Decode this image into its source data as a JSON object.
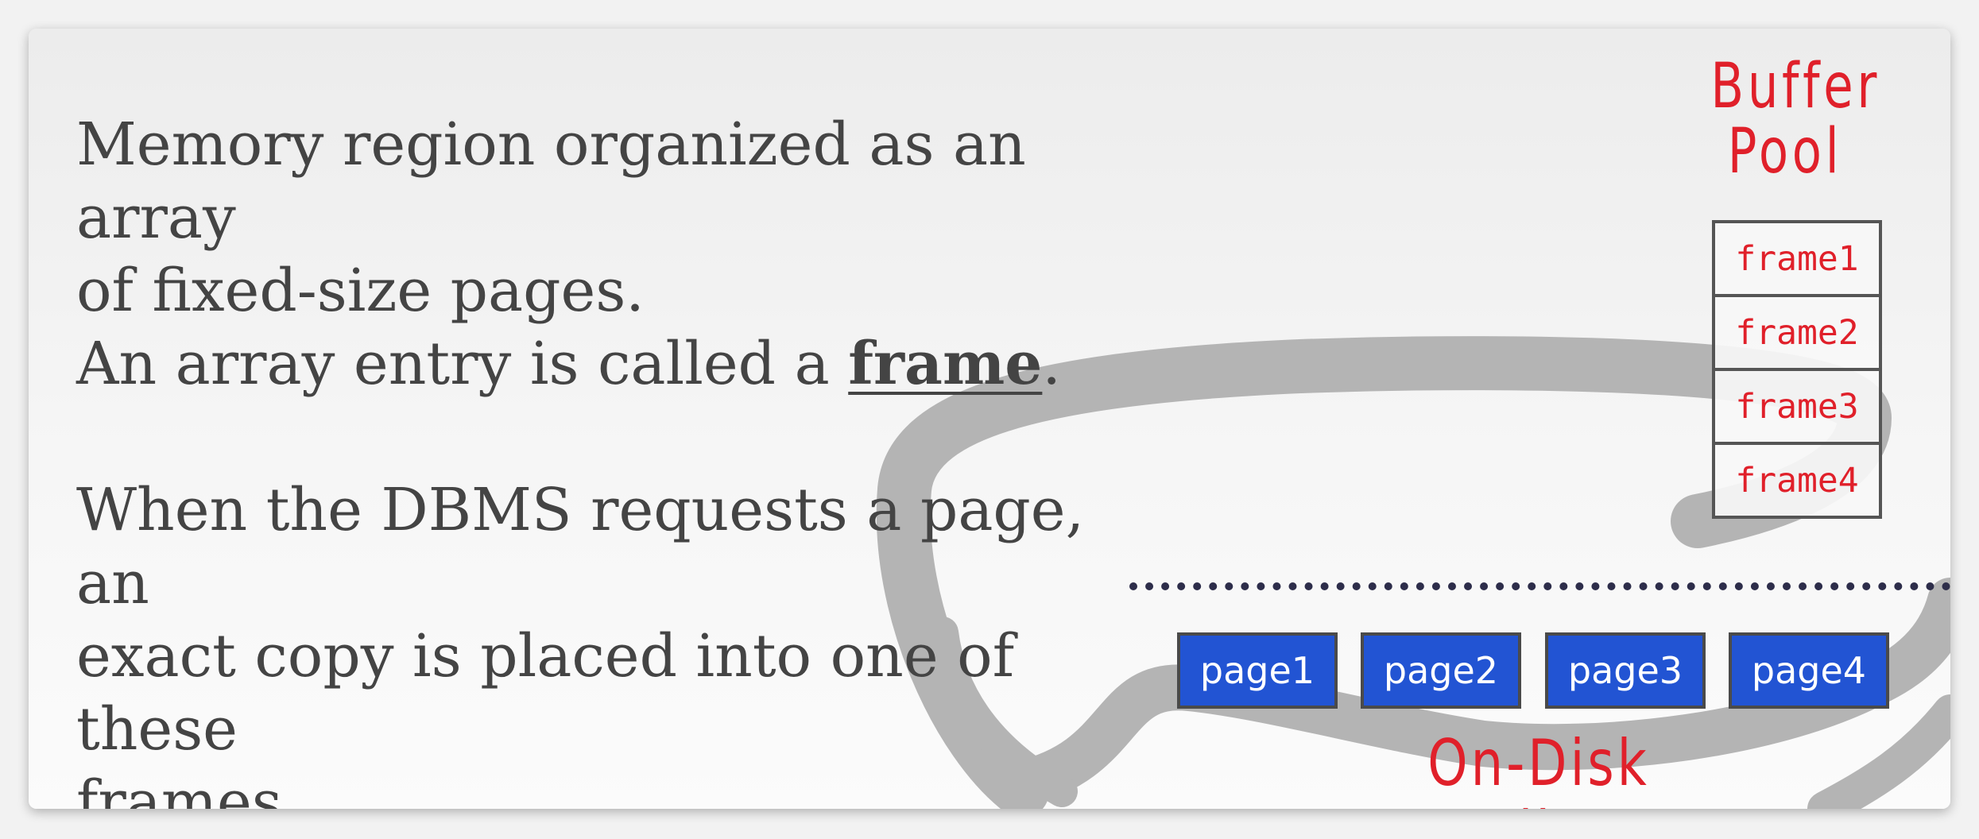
{
  "text": {
    "p1_l1": "Memory region organized as an array",
    "p1_l2": "of fixed-size pages.",
    "p1_l3_pre": "An array entry is called a ",
    "p1_l3_term": "frame",
    "p1_l3_post": ".",
    "p2_l1": "When the DBMS requests a page, an",
    "p2_l2": "exact copy is placed into one of these",
    "p2_l3": "frames."
  },
  "buffer_pool": {
    "title_line1": "Buffer",
    "title_line2": "Pool",
    "frames": [
      "frame1",
      "frame2",
      "frame3",
      "frame4"
    ]
  },
  "disk": {
    "label": "On-Disk File",
    "pages": [
      "page1",
      "page2",
      "page3",
      "page4"
    ]
  },
  "colors": {
    "accent_red": "#e0202a",
    "page_blue": "#2254d3",
    "text_gray": "#444444",
    "divider": "#2d2d4a"
  }
}
